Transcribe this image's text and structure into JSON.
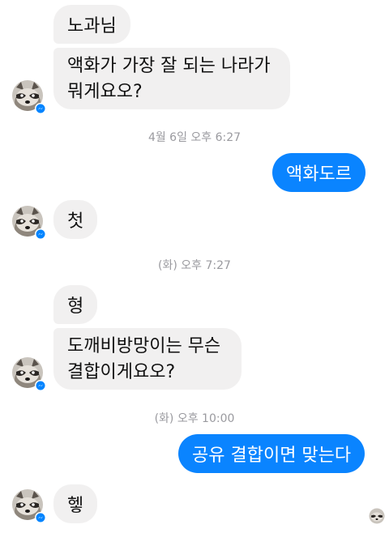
{
  "messages": {
    "m1": "노과님",
    "m2_line1": "액화가 가장 잘 되는 나라가",
    "m2_line2": "뭐게요오?",
    "m3": "액화도르",
    "m4": "첫",
    "m5": "형",
    "m6_line1": "도깨비방망이는 무슨",
    "m6_line2": "결합이게요오?",
    "m7": "공유 결합이면 맞는다",
    "m8": "헿"
  },
  "timestamps": {
    "t1": "4월 6일 오후 6:27",
    "t2": "(화) 오후 7:27",
    "t3": "(화) 오후 10:00"
  },
  "colors": {
    "outgoing_bubble": "#0a84ff",
    "incoming_bubble": "#f1f0f0",
    "timestamp_text": "#9a9a9f",
    "messenger_badge": "#0084ff"
  },
  "icons": {
    "avatar": "raccoon-avatar-icon",
    "badge": "messenger-badge-icon",
    "read_receipt": "read-receipt-avatar-icon"
  }
}
